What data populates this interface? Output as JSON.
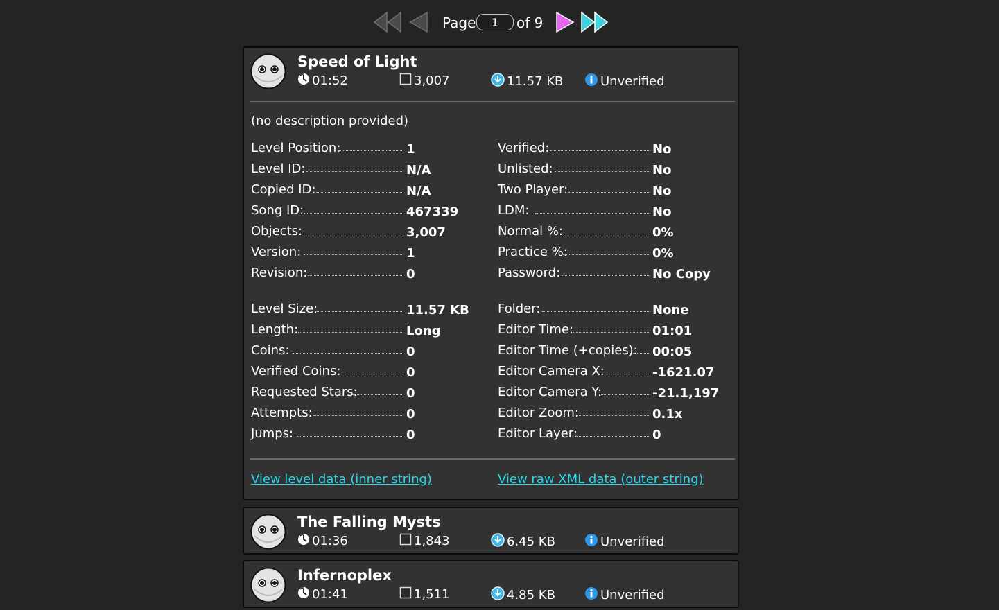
{
  "pager": {
    "page_label": "Page",
    "page_value": "1",
    "of_label": "of 9"
  },
  "levels": [
    {
      "name": "Speed of Light",
      "time": "01:52",
      "objects": "3,007",
      "size": "11.57 KB",
      "status": "Unverified",
      "description": "(no description provided)",
      "left_group1": [
        {
          "label": "Level Position:",
          "value": "1"
        },
        {
          "label": "Level ID:",
          "value": "N/A"
        },
        {
          "label": "Copied ID:",
          "value": "N/A"
        },
        {
          "label": "Song ID:",
          "value": "467339"
        },
        {
          "label": "Objects:",
          "value": "3,007"
        },
        {
          "label": "Version:",
          "value": "1"
        },
        {
          "label": "Revision:",
          "value": "0"
        }
      ],
      "right_group1": [
        {
          "label": "Verified:",
          "value": "No"
        },
        {
          "label": "Unlisted:",
          "value": "No"
        },
        {
          "label": "Two Player:",
          "value": "No"
        },
        {
          "label": "LDM:",
          "value": "No"
        },
        {
          "label": "Normal %:",
          "value": "0%"
        },
        {
          "label": "Practice %:",
          "value": "0%"
        },
        {
          "label": "Password:",
          "value": "No Copy"
        }
      ],
      "left_group2": [
        {
          "label": "Level Size:",
          "value": "11.57 KB"
        },
        {
          "label": "Length:",
          "value": "Long"
        },
        {
          "label": "Coins:",
          "value": "0"
        },
        {
          "label": "Verified Coins:",
          "value": "0"
        },
        {
          "label": "Requested Stars:",
          "value": "0"
        },
        {
          "label": "Attempts:",
          "value": "0"
        },
        {
          "label": "Jumps:",
          "value": "0"
        }
      ],
      "right_group2": [
        {
          "label": "Folder:",
          "value": "None"
        },
        {
          "label": "Editor Time:",
          "value": "01:01"
        },
        {
          "label": "Editor Time (+copies):",
          "value": "00:05"
        },
        {
          "label": "Editor Camera X:",
          "value": "-1621.07"
        },
        {
          "label": "Editor Camera Y:",
          "value": "-21.1,197"
        },
        {
          "label": "Editor Zoom:",
          "value": "0.1x"
        },
        {
          "label": "Editor Layer:",
          "value": "0"
        }
      ],
      "link_inner": "View level data (inner string)",
      "link_outer": "View raw XML data (outer string)"
    },
    {
      "name": "The Falling Mysts",
      "time": "01:36",
      "objects": "1,843",
      "size": "6.45 KB",
      "status": "Unverified"
    },
    {
      "name": "Infernoplex",
      "time": "01:41",
      "objects": "1,511",
      "size": "4.85 KB",
      "status": "Unverified"
    }
  ],
  "colors": {
    "background": "#242424",
    "card": "#323232",
    "link": "#26d7ea",
    "next_arrow": "#e766f0",
    "last_arrow": "#3fd0e0"
  },
  "icons": {
    "first_page": "double-left-triangle-icon",
    "prev_page": "left-triangle-icon",
    "next_page": "right-triangle-icon",
    "last_page": "double-right-triangle-icon",
    "avatar": "robot-face-icon",
    "time": "clock-icon",
    "objects": "square-outline-icon",
    "size": "download-disc-icon",
    "status": "info-icon"
  }
}
